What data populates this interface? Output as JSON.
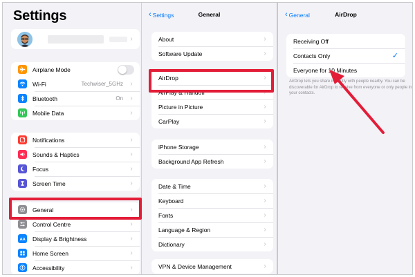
{
  "settings": {
    "title": "Settings",
    "airplane_label": "Airplane Mode",
    "groups": [
      [
        {
          "label": "Wi-Fi",
          "value": "Techwiser_5GHz",
          "icon": "wifi-icon",
          "color": "#0a84ff"
        },
        {
          "label": "Bluetooth",
          "value": "On",
          "icon": "bluetooth-icon",
          "color": "#0a84ff"
        },
        {
          "label": "Mobile Data",
          "value": "",
          "icon": "antenna-icon",
          "color": "#34c759"
        }
      ],
      [
        {
          "label": "Notifications",
          "value": "",
          "icon": "bell-icon",
          "color": "#ff3b30"
        },
        {
          "label": "Sounds & Haptics",
          "value": "",
          "icon": "speaker-icon",
          "color": "#ff2d55"
        },
        {
          "label": "Focus",
          "value": "",
          "icon": "moon-icon",
          "color": "#5856d6"
        },
        {
          "label": "Screen Time",
          "value": "",
          "icon": "hourglass-icon",
          "color": "#5856d6"
        }
      ],
      [
        {
          "label": "General",
          "value": "",
          "icon": "gear-icon",
          "color": "#8e8e93"
        },
        {
          "label": "Control Centre",
          "value": "",
          "icon": "sliders-icon",
          "color": "#8e8e93"
        },
        {
          "label": "Display & Brightness",
          "value": "",
          "icon": "text-size-icon",
          "color": "#0a84ff"
        },
        {
          "label": "Home Screen",
          "value": "",
          "icon": "grid-icon",
          "color": "#0a84ff"
        },
        {
          "label": "Accessibility",
          "value": "",
          "icon": "accessibility-icon",
          "color": "#0a84ff"
        }
      ]
    ]
  },
  "general": {
    "back_label": "Settings",
    "title": "General",
    "groups": [
      [
        "About",
        "Software Update"
      ],
      [
        "AirDrop",
        "AirPlay & Handoff",
        "Picture in Picture",
        "CarPlay"
      ],
      [
        "iPhone Storage",
        "Background App Refresh"
      ],
      [
        "Date & Time",
        "Keyboard",
        "Fonts",
        "Language & Region",
        "Dictionary"
      ],
      [
        "VPN & Device Management"
      ]
    ]
  },
  "airdrop": {
    "back_label": "General",
    "title": "AirDrop",
    "options": [
      "Receiving Off",
      "Contacts Only",
      "Everyone for 10 Minutes"
    ],
    "selected": "Contacts Only",
    "description": "AirDrop lets you share instantly with people nearby. You can be discoverable for AirDrop to receive from everyone or only people in your contacts."
  },
  "colors": {
    "accent": "#007aff",
    "highlight": "#e31d38",
    "airplane": "#ff9500"
  }
}
